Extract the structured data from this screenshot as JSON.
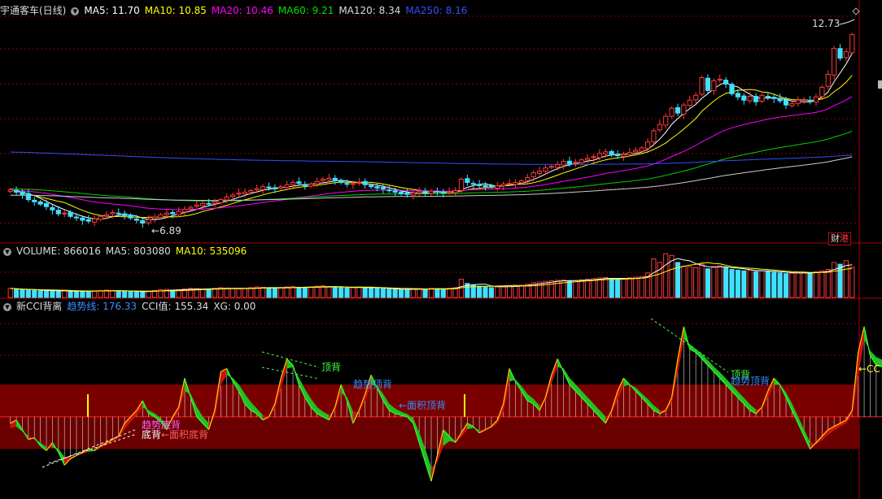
{
  "headers": {
    "main": {
      "title": "宇通客车(日线)",
      "items": [
        {
          "label": "MA5: 11.70",
          "color": "#ffffff"
        },
        {
          "label": "MA10: 10.85",
          "color": "#ffff00"
        },
        {
          "label": "MA20: 10.46",
          "color": "#ff00ff"
        },
        {
          "label": "MA60: 9.21",
          "color": "#00e000"
        },
        {
          "label": "MA120: 8.34",
          "color": "#dddddd"
        },
        {
          "label": "MA250: 8.16",
          "color": "#3050ff"
        }
      ]
    },
    "volume": {
      "items": [
        {
          "label": "VOLUME: 866016",
          "color": "#dddddd"
        },
        {
          "label": "MA5: 803080",
          "color": "#dddddd"
        },
        {
          "label": "MA10: 535096",
          "color": "#ffff00"
        }
      ]
    },
    "cci": {
      "title": "新CCI背离",
      "items": [
        {
          "label": "趋势线: 176.33",
          "color": "#3a8cff"
        },
        {
          "label": "CCI值: 155.34",
          "color": "#dddddd"
        },
        {
          "label": "XG: 0.00",
          "color": "#dddddd"
        }
      ]
    }
  },
  "annotations": {
    "price_high": "12.73",
    "price_low": "6.89",
    "news_badge": "财",
    "news_badge2": "港",
    "top_div_1": "顶背",
    "trend_top_div_1": "趋势顶背",
    "area_top_div": "←面积顶背",
    "trend_bottom_div": "趋势底背",
    "bottom_div": "底背",
    "area_bottom_div": "←面积底背",
    "top_div_2": "顶背",
    "trend_top_div_2": "趋势顶背",
    "cci_arrow_label": "←CC"
  },
  "colors": {
    "up": "#ff3a3a",
    "down": "#40e0ff",
    "cci_up_fill": "#cc1010",
    "cci_down_fill": "#22c020",
    "overbought_band": "#7a0000",
    "oversold_band": "#6a0000",
    "grid": "#8b0000"
  },
  "chart_data": [
    {
      "type": "candlestick",
      "title": "宇通客车(日线)",
      "ylim": [
        6.3,
        13.3
      ],
      "grid": true,
      "moving_averages": [
        {
          "name": "MA5",
          "last": 11.7
        },
        {
          "name": "MA10",
          "last": 10.85
        },
        {
          "name": "MA20",
          "last": 10.46
        },
        {
          "name": "MA60",
          "last": 9.21
        },
        {
          "name": "MA120",
          "last": 8.34
        },
        {
          "name": "MA250",
          "last": 8.16
        }
      ],
      "labels": {
        "high": 12.73,
        "low": 6.89
      },
      "close": [
        7.92,
        7.85,
        7.78,
        7.62,
        7.55,
        7.48,
        7.4,
        7.3,
        7.18,
        7.2,
        7.1,
        7.05,
        6.98,
        6.95,
        7.02,
        7.1,
        7.15,
        7.22,
        7.18,
        7.12,
        7.05,
        6.98,
        6.89,
        7.0,
        7.08,
        7.15,
        7.2,
        7.18,
        7.25,
        7.32,
        7.38,
        7.45,
        7.5,
        7.48,
        7.55,
        7.62,
        7.7,
        7.76,
        7.82,
        7.85,
        7.9,
        7.96,
        8.02,
        7.98,
        7.95,
        8.02,
        8.08,
        8.15,
        8.12,
        8.05,
        8.1,
        8.18,
        8.25,
        8.28,
        8.2,
        8.15,
        8.1,
        8.12,
        8.15,
        8.08,
        8.02,
        7.98,
        7.95,
        7.9,
        7.85,
        7.8,
        7.78,
        7.82,
        7.86,
        7.84,
        7.88,
        7.85,
        7.82,
        7.86,
        7.9,
        8.25,
        8.15,
        8.1,
        8.05,
        8.02,
        8.0,
        8.05,
        8.1,
        8.12,
        8.15,
        8.2,
        8.3,
        8.45,
        8.5,
        8.6,
        8.65,
        8.7,
        8.8,
        8.72,
        8.78,
        8.85,
        8.9,
        8.95,
        9.05,
        9.1,
        9.0,
        8.98,
        9.02,
        9.08,
        9.15,
        9.22,
        9.4,
        9.75,
        9.95,
        10.2,
        10.45,
        10.3,
        10.55,
        10.7,
        10.85,
        11.4,
        11.0,
        11.3,
        11.35,
        11.2,
        10.9,
        10.8,
        10.7,
        10.82,
        10.65,
        10.85,
        10.8,
        10.75,
        10.68,
        10.55,
        10.6,
        10.7,
        10.72,
        10.65,
        10.8,
        11.1,
        11.5,
        12.3,
        12.0,
        12.2,
        12.73
      ]
    },
    {
      "type": "bar",
      "title": "VOLUME",
      "labels": {
        "volume": 866016,
        "ma5": 803080,
        "ma10": 535096
      },
      "values": [
        260000,
        240000,
        220000,
        210000,
        200000,
        190000,
        200000,
        185000,
        180000,
        190000,
        175000,
        170000,
        180000,
        185000,
        190000,
        200000,
        210000,
        190000,
        180000,
        170000,
        175000,
        165000,
        160000,
        180000,
        200000,
        220000,
        230000,
        210000,
        220000,
        240000,
        260000,
        250000,
        230000,
        240000,
        260000,
        280000,
        270000,
        250000,
        240000,
        260000,
        280000,
        300000,
        290000,
        270000,
        260000,
        280000,
        300000,
        310000,
        290000,
        280000,
        300000,
        320000,
        330000,
        310000,
        290000,
        280000,
        270000,
        280000,
        300000,
        290000,
        270000,
        260000,
        250000,
        240000,
        230000,
        220000,
        230000,
        240000,
        250000,
        240000,
        260000,
        250000,
        240000,
        260000,
        280000,
        520000,
        400000,
        350000,
        320000,
        300000,
        280000,
        300000,
        320000,
        330000,
        340000,
        350000,
        380000,
        420000,
        440000,
        460000,
        480000,
        490000,
        500000,
        470000,
        480000,
        500000,
        520000,
        540000,
        560000,
        570000,
        540000,
        520000,
        530000,
        560000,
        580000,
        600000,
        700000,
        1100000,
        1000000,
        1250000,
        1200000,
        1000000,
        900000,
        880000,
        850000,
        950000,
        820000,
        860000,
        900000,
        860000,
        800000,
        780000,
        760000,
        780000,
        740000,
        760000,
        750000,
        720000,
        700000,
        680000,
        690000,
        700000,
        720000,
        700000,
        730000,
        760000,
        800000,
        1000000,
        950000,
        1050000,
        866016
      ]
    },
    {
      "type": "line",
      "title": "新CCI背离",
      "ylim": [
        -250,
        320
      ],
      "series": [
        {
          "name": "趋势线",
          "last": 176.33
        },
        {
          "name": "CCI值",
          "last": 155.34
        }
      ],
      "levels": [
        100,
        0,
        -100
      ],
      "cci": [
        -20,
        -10,
        -40,
        -70,
        -65,
        -90,
        -105,
        -80,
        -110,
        -150,
        -130,
        -120,
        -110,
        -100,
        -105,
        -90,
        -80,
        -70,
        -60,
        -20,
        0,
        20,
        50,
        10,
        0,
        -15,
        -40,
        0,
        30,
        120,
        60,
        0,
        -20,
        -40,
        20,
        140,
        150,
        110,
        80,
        40,
        20,
        10,
        -10,
        0,
        40,
        120,
        180,
        160,
        100,
        60,
        30,
        10,
        0,
        -10,
        30,
        100,
        50,
        -20,
        20,
        70,
        130,
        90,
        50,
        20,
        10,
        5,
        0,
        -20,
        -80,
        -140,
        -200,
        -120,
        -40,
        -60,
        -80,
        -50,
        -20,
        -30,
        -50,
        -40,
        -30,
        -10,
        40,
        150,
        110,
        80,
        50,
        40,
        20,
        60,
        130,
        180,
        140,
        100,
        80,
        60,
        40,
        20,
        0,
        -20,
        20,
        80,
        120,
        100,
        80,
        60,
        40,
        20,
        10,
        20,
        60,
        180,
        280,
        210,
        200,
        180,
        160,
        140,
        120,
        100,
        80,
        60,
        40,
        20,
        10,
        30,
        80,
        120,
        100,
        60,
        20,
        -20,
        -60,
        -100,
        -80,
        -60,
        -40,
        -30,
        -20,
        -10,
        20,
        200,
        280,
        190,
        160,
        155.34
      ],
      "trend": [
        -35,
        -30,
        -45,
        -60,
        -70,
        -80,
        -95,
        -95,
        -100,
        -125,
        -125,
        -120,
        -115,
        -108,
        -105,
        -96,
        -86,
        -76,
        -66,
        -38,
        -15,
        5,
        30,
        20,
        10,
        -5,
        -25,
        -10,
        15,
        80,
        70,
        30,
        0,
        -20,
        0,
        100,
        130,
        120,
        100,
        70,
        45,
        25,
        5,
        0,
        25,
        90,
        150,
        155,
        120,
        85,
        55,
        30,
        15,
        5,
        20,
        75,
        60,
        15,
        15,
        50,
        100,
        95,
        70,
        40,
        25,
        15,
        8,
        -5,
        -50,
        -100,
        -160,
        -140,
        -90,
        -75,
        -78,
        -62,
        -38,
        -34,
        -42,
        -40,
        -34,
        -20,
        15,
        110,
        115,
        95,
        70,
        55,
        35,
        50,
        105,
        155,
        150,
        120,
        100,
        80,
        60,
        40,
        20,
        0,
        10,
        55,
        95,
        100,
        90,
        72,
        55,
        35,
        20,
        18,
        45,
        140,
        240,
        225,
        210,
        195,
        175,
        155,
        138,
        118,
        98,
        78,
        58,
        38,
        22,
        26,
        60,
        100,
        100,
        75,
        40,
        0,
        -40,
        -80,
        -85,
        -72,
        -55,
        -42,
        -30,
        -20,
        5,
        130,
        240,
        205,
        185,
        176.33
      ]
    }
  ]
}
